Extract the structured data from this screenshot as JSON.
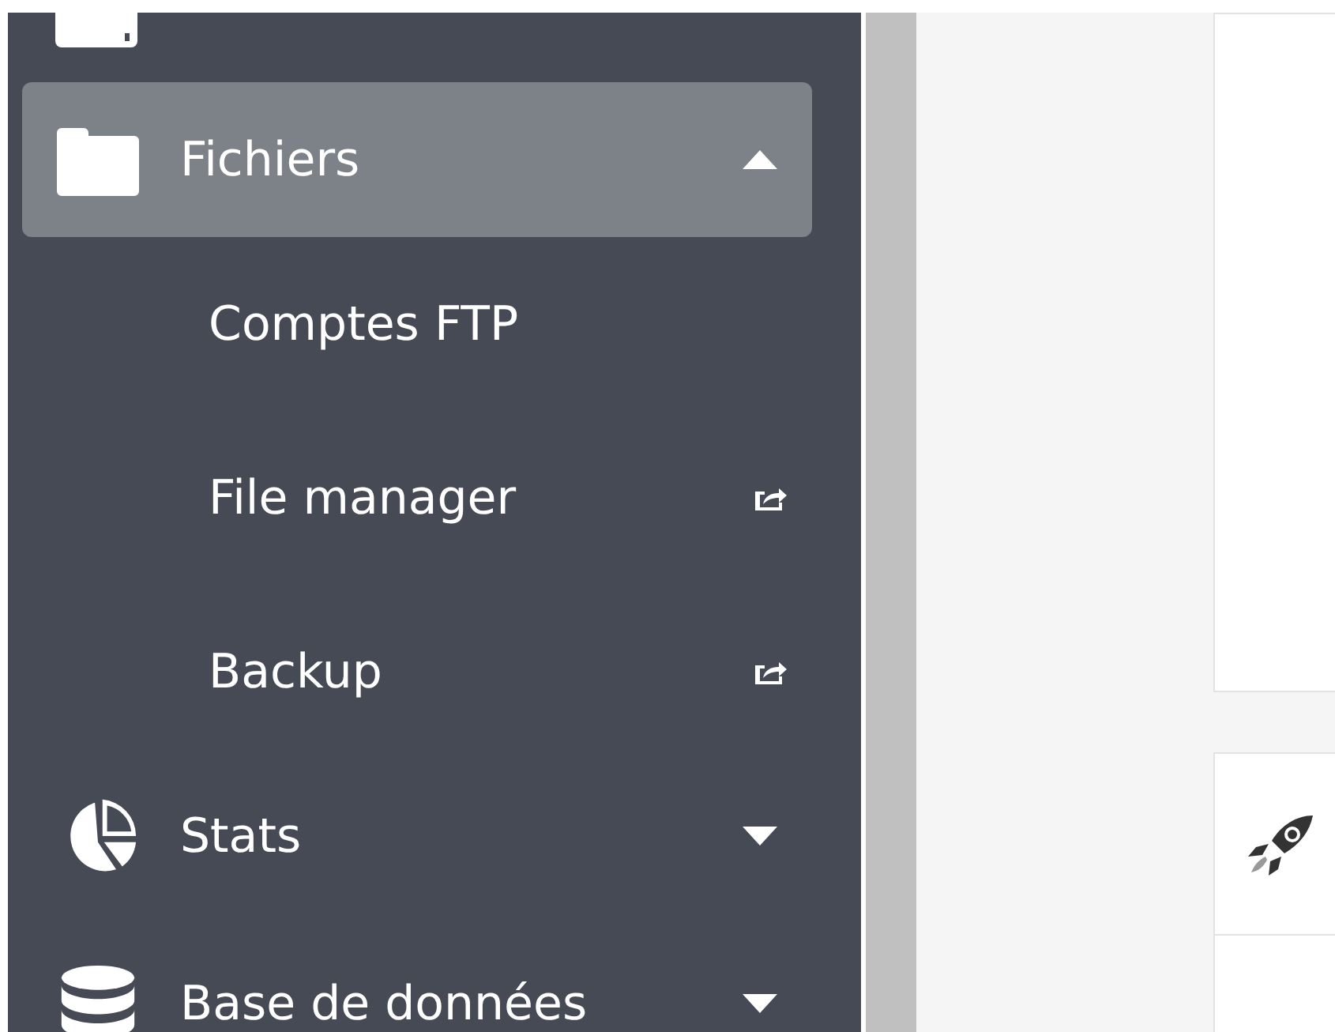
{
  "sidebar": {
    "items": [
      {
        "label": "Fichiers",
        "expanded": true,
        "children": [
          {
            "label": "Comptes FTP",
            "external": false
          },
          {
            "label": "File manager",
            "external": true
          },
          {
            "label": "Backup",
            "external": true
          }
        ]
      },
      {
        "label": "Stats",
        "expanded": false
      },
      {
        "label": "Base de données",
        "expanded": false
      }
    ]
  }
}
